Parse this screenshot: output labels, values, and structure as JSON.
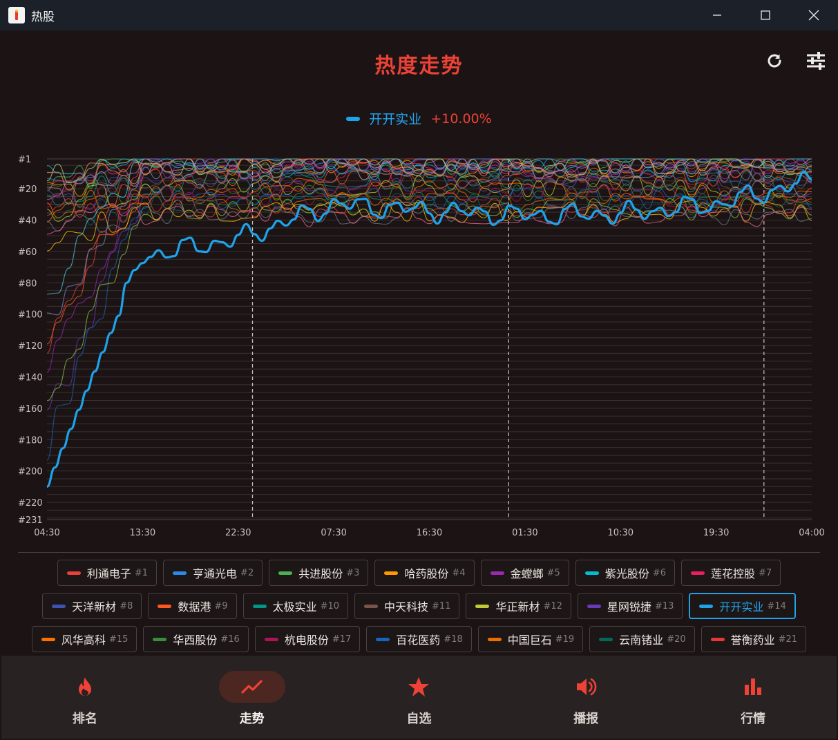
{
  "window": {
    "title": "热股"
  },
  "header": {
    "title": "热度走势"
  },
  "legend": {
    "name": "开开实业",
    "change": "+10.00%",
    "color": "#1ea2ea"
  },
  "chart_data": {
    "type": "line",
    "title": "热度走势",
    "y_axis": {
      "reversed": true,
      "ticks": [
        "#1",
        "#20",
        "#40",
        "#60",
        "#80",
        "#100",
        "#120",
        "#140",
        "#160",
        "#180",
        "#200",
        "#220",
        "#231"
      ],
      "range": [
        1,
        231
      ]
    },
    "x_axis": {
      "ticks": [
        "04:30",
        "13:30",
        "22:30",
        "07:30",
        "16:30",
        "01:30",
        "10:30",
        "19:30",
        "04:00"
      ]
    },
    "day_separators": [
      "23:00",
      "00:00",
      "00:00"
    ],
    "highlighted_series": {
      "name": "开开实业",
      "rank_at_tick": [
        210,
        63,
        52,
        30,
        34,
        37,
        36,
        30,
        15
      ]
    },
    "grid": true,
    "legend_position": "top-center"
  },
  "chips": [
    [
      {
        "name": "利通电子",
        "rank": "#1",
        "color": "#e8403a"
      },
      {
        "name": "亨通光电",
        "rank": "#2",
        "color": "#2a8be6"
      },
      {
        "name": "共进股份",
        "rank": "#3",
        "color": "#4caf50"
      },
      {
        "name": "哈药股份",
        "rank": "#4",
        "color": "#ff9800"
      },
      {
        "name": "金螳螂",
        "rank": "#5",
        "color": "#9c27b0"
      },
      {
        "name": "紫光股份",
        "rank": "#6",
        "color": "#00bcd4"
      },
      {
        "name": "莲花控股",
        "rank": "#7",
        "color": "#e91e63"
      }
    ],
    [
      {
        "name": "天洋新材",
        "rank": "#8",
        "color": "#3f51b5"
      },
      {
        "name": "数据港",
        "rank": "#9",
        "color": "#ff5722"
      },
      {
        "name": "太极实业",
        "rank": "#10",
        "color": "#009688"
      },
      {
        "name": "中天科技",
        "rank": "#11",
        "color": "#795548"
      },
      {
        "name": "华正新材",
        "rank": "#12",
        "color": "#c0ca33"
      },
      {
        "name": "星网锐捷",
        "rank": "#13",
        "color": "#673ab7"
      },
      {
        "name": "开开实业",
        "rank": "#14",
        "color": "#1ea2ea",
        "selected": true
      }
    ],
    [
      {
        "name": "风华高科",
        "rank": "#15",
        "color": "#ff6f00"
      },
      {
        "name": "华西股份",
        "rank": "#16",
        "color": "#388e3c"
      },
      {
        "name": "杭电股份",
        "rank": "#17",
        "color": "#ad1457"
      },
      {
        "name": "百花医药",
        "rank": "#18",
        "color": "#1565c0"
      },
      {
        "name": "中国巨石",
        "rank": "#19",
        "color": "#ef6c00"
      },
      {
        "name": "云南锗业",
        "rank": "#20",
        "color": "#00695c"
      },
      {
        "name": "誉衡药业",
        "rank": "#21",
        "color": "#e53935"
      }
    ]
  ],
  "nav": [
    {
      "label": "排名",
      "icon": "fire-icon"
    },
    {
      "label": "走势",
      "icon": "trend-icon",
      "active": true
    },
    {
      "label": "自选",
      "icon": "star-icon"
    },
    {
      "label": "播报",
      "icon": "speaker-icon"
    },
    {
      "label": "行情",
      "icon": "bar-chart-icon"
    }
  ],
  "colors": {
    "accent": "#ee4236",
    "highlight": "#1ea2ea",
    "background": "#1c1414"
  }
}
